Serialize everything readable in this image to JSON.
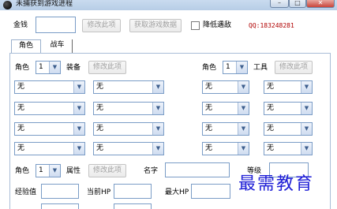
{
  "window": {
    "title": "未捕获到游戏进程",
    "min_icon": "minimize-icon",
    "max_icon": "maximize-icon",
    "close_icon": "close-icon"
  },
  "top": {
    "money_label": "金钱",
    "money_value": "",
    "modify_label": "修改此项",
    "fetch_label": "获取游戏数据",
    "lower_encounter_label": "降低遇敌",
    "lower_encounter_checked": false,
    "qq_text": "QQ:183248281"
  },
  "tabs": [
    {
      "label": "角色",
      "active": true
    },
    {
      "label": "战车",
      "active": false
    }
  ],
  "equip": {
    "role_label": "角色",
    "role_value": "1",
    "equip_label": "装备",
    "modify_label": "修改此项",
    "rows": [
      [
        "无",
        "无"
      ],
      [
        "无",
        "无"
      ],
      [
        "无",
        "无"
      ],
      [
        "无",
        "无"
      ]
    ]
  },
  "tools": {
    "role_label": "角色",
    "role_value": "1",
    "tool_label": "工具",
    "modify_label": "修改此项",
    "rows": [
      [
        "无",
        "无"
      ],
      [
        "无",
        "无"
      ],
      [
        "无",
        "无"
      ],
      [
        "无",
        "无"
      ]
    ]
  },
  "attr": {
    "role_label": "角色",
    "role_value": "1",
    "attr_label": "属性",
    "modify_label": "修改此项",
    "name_label": "名字",
    "name_value": "",
    "level_label": "等级",
    "level_value": "",
    "exp_label": "经验值",
    "exp_value": "",
    "hp_label": "当前HP",
    "hp_value": "",
    "maxhp_label": "最大HP",
    "maxhp_value": ""
  },
  "watermark": "最需教育"
}
